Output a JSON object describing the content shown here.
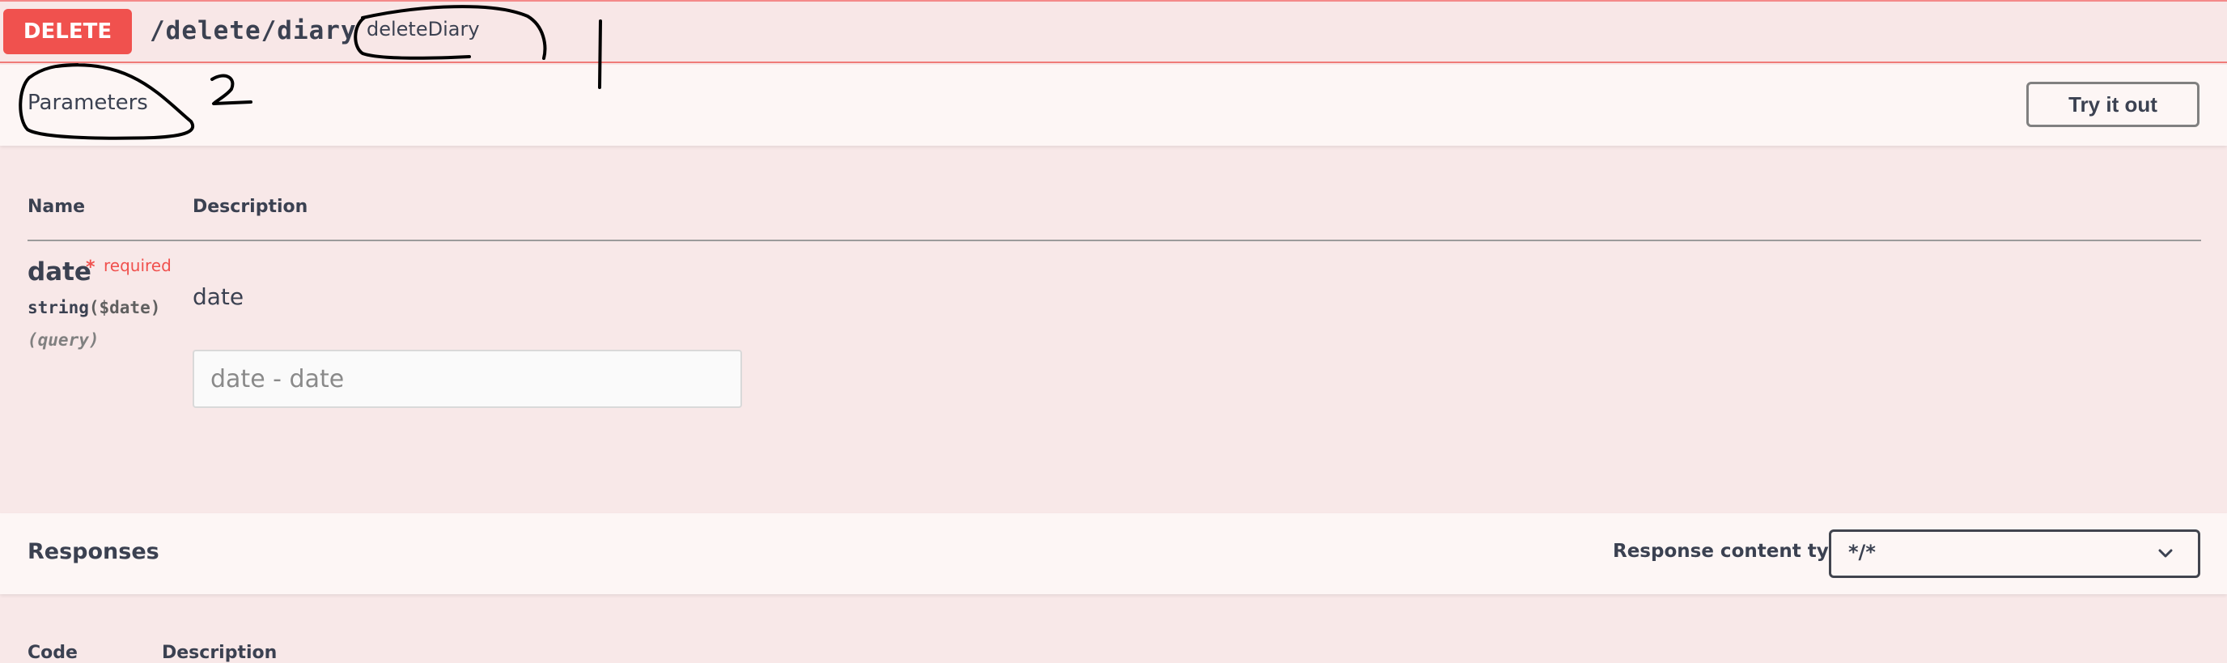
{
  "operation": {
    "method": "DELETE",
    "path": "/delete/diary",
    "summary": "deleteDiary"
  },
  "parameters": {
    "title": "Parameters",
    "try_label": "Try it out",
    "columns": {
      "name": "Name",
      "description": "Description"
    },
    "items": [
      {
        "name": "date",
        "required_star": "*",
        "required_label": "required",
        "type": "string",
        "format": "($date)",
        "in": "(query)",
        "description": "date",
        "placeholder": "date - date"
      }
    ]
  },
  "responses": {
    "title": "Responses",
    "content_type_label": "Response content type",
    "content_type_value": "*/*",
    "columns": {
      "code": "Code",
      "description": "Description"
    }
  },
  "annotations": {
    "mark_1": "1",
    "mark_2": "2"
  },
  "colors": {
    "delete": "#f0514e",
    "background": "#f8e8e8"
  },
  "icons": {
    "select_arrow": "chevron-down-icon"
  }
}
